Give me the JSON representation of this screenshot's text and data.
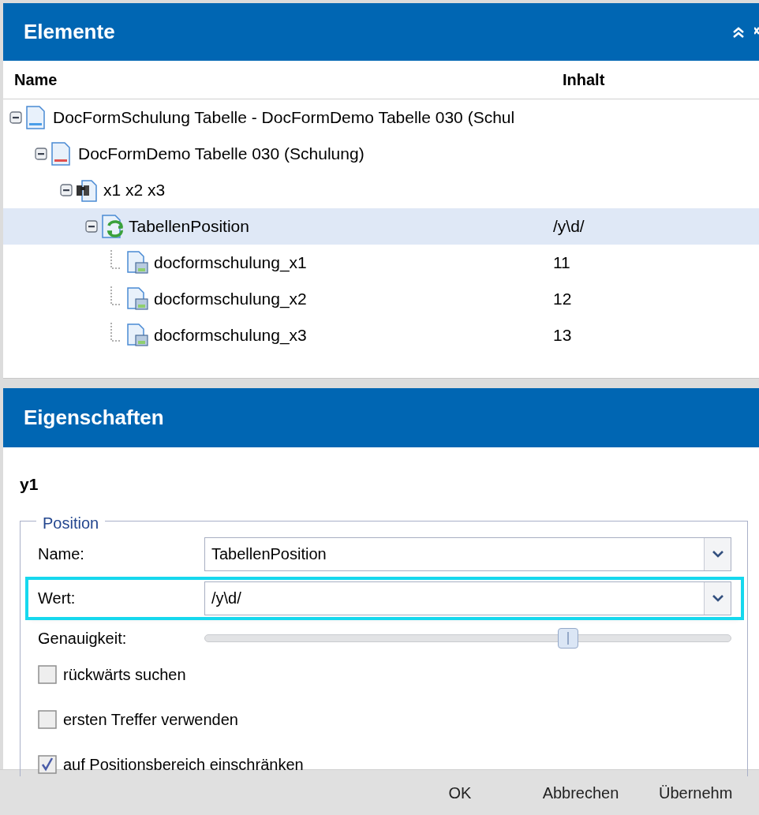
{
  "elements_panel": {
    "title": "Elemente",
    "columns": [
      "Name",
      "Inhalt"
    ],
    "tree": [
      {
        "label": "DocFormSchulung Tabelle - DocFormDemo Tabelle 030 (Schul",
        "kind": "doc-blue",
        "expanded": true,
        "selected": false,
        "children": [
          {
            "label": "DocFormDemo Tabelle 030 (Schulung)",
            "kind": "doc-red",
            "expanded": true,
            "selected": false,
            "children": [
              {
                "label": "x1 x2 x3",
                "kind": "binoculars",
                "expanded": true,
                "selected": false,
                "children": [
                  {
                    "label": "TabellenPosition",
                    "content": "/y\\d/",
                    "kind": "refresh",
                    "expanded": true,
                    "selected": true,
                    "children": [
                      {
                        "label": "docformschulung_x1",
                        "content": "11",
                        "kind": "field",
                        "selected": false
                      },
                      {
                        "label": "docformschulung_x2",
                        "content": "12",
                        "kind": "field",
                        "selected": false
                      },
                      {
                        "label": "docformschulung_x3",
                        "content": "13",
                        "kind": "field",
                        "selected": false
                      }
                    ]
                  }
                ]
              }
            ]
          }
        ]
      }
    ]
  },
  "properties_panel": {
    "title": "Eigenschaften",
    "heading": "y1",
    "group": "Position",
    "fields": [
      {
        "kind": "dropdown",
        "label": "Name:",
        "value": "TabellenPosition",
        "highlighted": false
      },
      {
        "kind": "dropdown",
        "label": "Wert:",
        "value": "/y\\d/",
        "highlighted": true
      },
      {
        "kind": "slider",
        "label": "Genauigkeit:",
        "level": 0.69
      }
    ],
    "checkboxes": [
      {
        "label": "rückwärts suchen",
        "checked": false
      },
      {
        "label": "ersten Treffer verwenden",
        "checked": false
      },
      {
        "label": "auf Positionsbereich einschränken",
        "checked": true
      }
    ]
  },
  "buttons": [
    "OK",
    "Abbrechen",
    "Übernehm"
  ]
}
